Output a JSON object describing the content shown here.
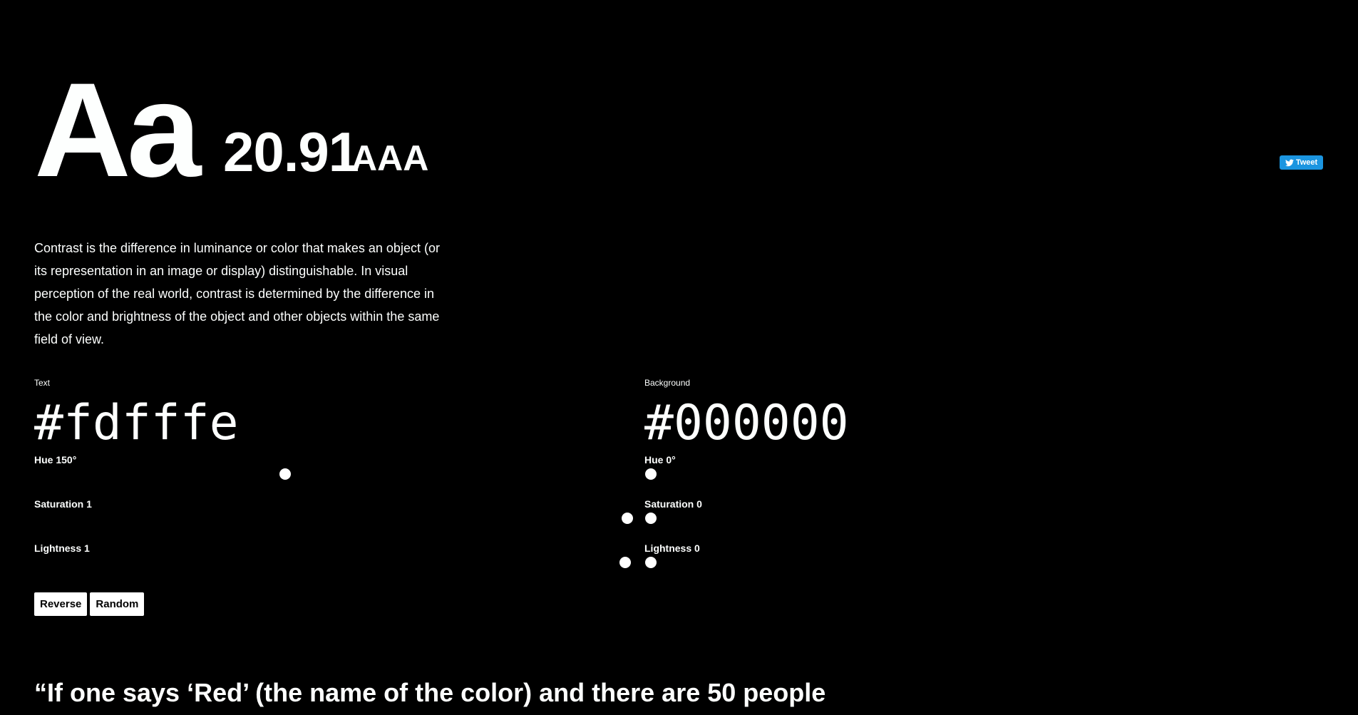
{
  "hero": {
    "sample": "Aa",
    "ratio": "20.91",
    "level": "AAA"
  },
  "tweet": {
    "label": "Tweet",
    "icon": "twitter-bird-icon",
    "color": "#1b95e0"
  },
  "description": "Contrast is the difference in luminance or color that makes an object (or its representation in an image or display) distinguishable. In visual perception of the real world, contrast is determined by the difference in the color and brightness of the object and other objects within the same field of view.",
  "text_color": {
    "label": "Text",
    "hex": "#fdfffe",
    "hue_label": "Hue 150°",
    "saturation_label": "Saturation 1",
    "lightness_label": "Lightness 1",
    "hue": 150,
    "saturation": 1,
    "lightness": 1
  },
  "background_color": {
    "label": "Background",
    "hex": "#000000",
    "hue_label": "Hue 0°",
    "saturation_label": "Saturation 0",
    "lightness_label": "Lightness 0",
    "hue": 0,
    "saturation": 0,
    "lightness": 0
  },
  "buttons": {
    "reverse": "Reverse",
    "random": "Random"
  },
  "quote": "“If one says ‘Red’ (the name of the color) and there are 50 people"
}
